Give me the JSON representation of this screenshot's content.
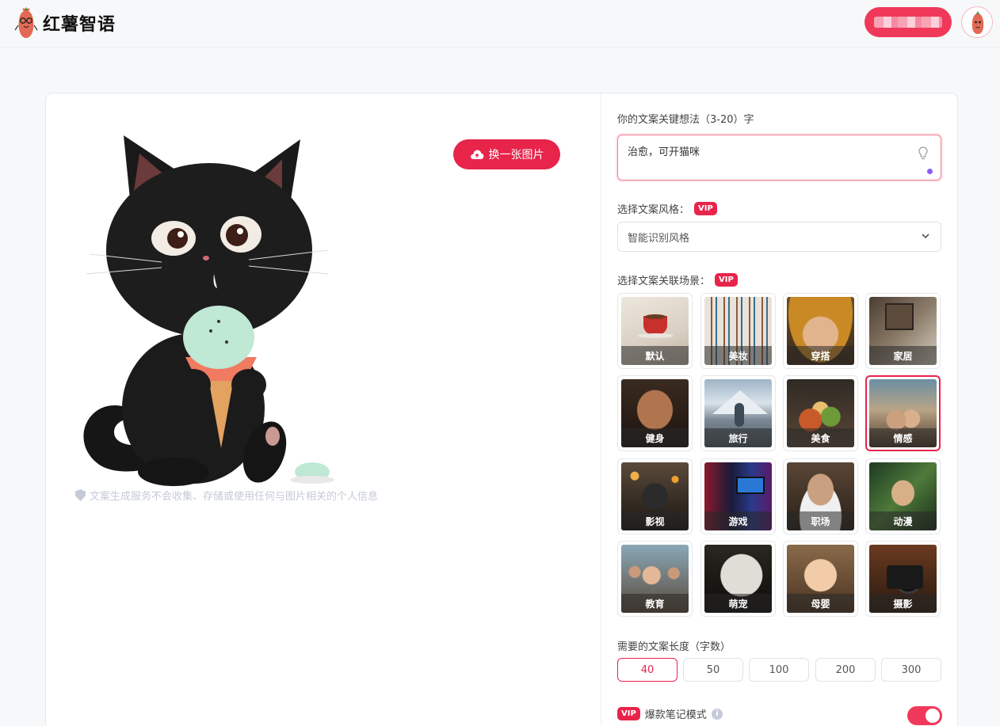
{
  "app": {
    "name": "红薯智语"
  },
  "header": {
    "account_button_label": ""
  },
  "left": {
    "change_image_label": "换一张图片",
    "privacy_note": "文案生成服务不会收集、存储或使用任何与图片相关的个人信息"
  },
  "form": {
    "idea_label": "你的文案关键想法（3-20）字",
    "idea_value": "治愈，可开猫咪",
    "style_label": "选择文案风格：",
    "style_vip": "VIP",
    "style_selected": "智能识别风格",
    "scene_label": "选择文案关联场景：",
    "scene_vip": "VIP",
    "scenes": [
      {
        "label": "默认",
        "selected": false
      },
      {
        "label": "美妆",
        "selected": false
      },
      {
        "label": "穿搭",
        "selected": false
      },
      {
        "label": "家居",
        "selected": false
      },
      {
        "label": "健身",
        "selected": false
      },
      {
        "label": "旅行",
        "selected": false
      },
      {
        "label": "美食",
        "selected": false
      },
      {
        "label": "情感",
        "selected": true
      },
      {
        "label": "影视",
        "selected": false
      },
      {
        "label": "游戏",
        "selected": false
      },
      {
        "label": "职场",
        "selected": false
      },
      {
        "label": "动漫",
        "selected": false
      },
      {
        "label": "教育",
        "selected": false
      },
      {
        "label": "萌宠",
        "selected": false
      },
      {
        "label": "母婴",
        "selected": false
      },
      {
        "label": "摄影",
        "selected": false
      }
    ],
    "length_label": "需要的文案长度（字数）",
    "lengths": [
      "40",
      "50",
      "100",
      "200",
      "300"
    ],
    "length_selected": "40",
    "mode_vip": "VIP",
    "mode_label": "爆款笔记模式",
    "mode_on": true
  },
  "colors": {
    "accent": "#e8244b",
    "header_button": "#f0395a",
    "purple_dot": "#8b5cf6"
  }
}
